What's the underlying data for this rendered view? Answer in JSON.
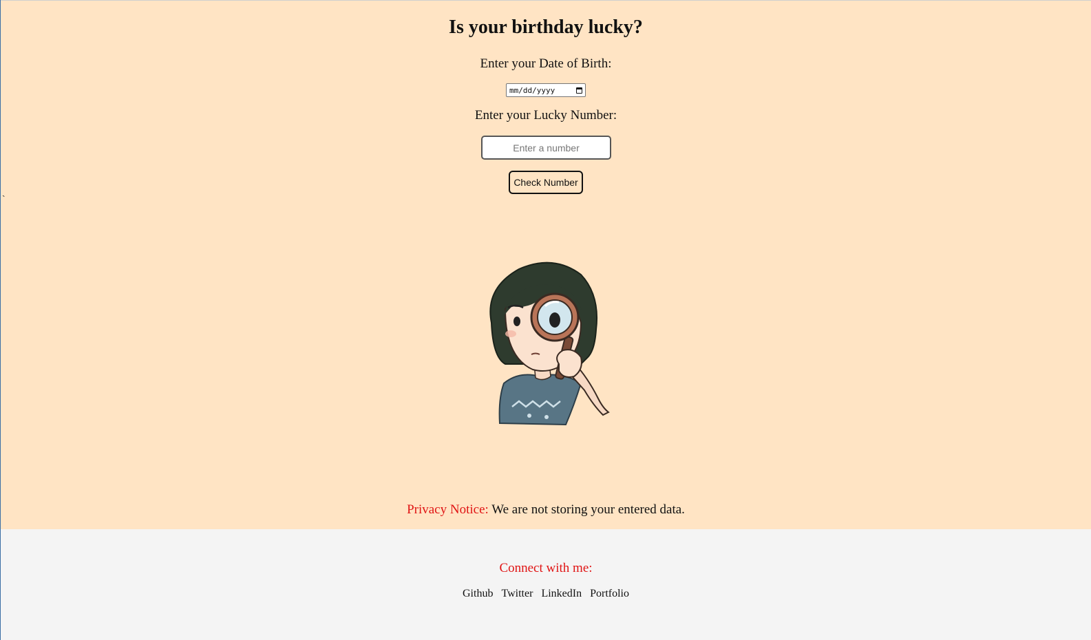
{
  "header": {
    "title": "Is your birthday lucky?"
  },
  "form": {
    "dob_label": "Enter your Date of Birth:",
    "dob_placeholder": "mm/dd/yyyy",
    "lucky_label": "Enter your Lucky Number:",
    "number_placeholder": "Enter a number",
    "number_value": "",
    "check_button": "Check Number"
  },
  "stray_text": "`",
  "illustration": {
    "icon": "girl-with-magnifying-glass"
  },
  "privacy": {
    "label": "Privacy Notice:",
    "text": "We are not storing your entered data."
  },
  "footer": {
    "connect_label": "Connect with me:",
    "links": [
      "Github",
      "Twitter",
      "LinkedIn",
      "Portfolio"
    ]
  },
  "colors": {
    "main_bg": "#ffe4c4",
    "footer_bg": "#f4f4f4",
    "accent_red": "#e01414"
  }
}
